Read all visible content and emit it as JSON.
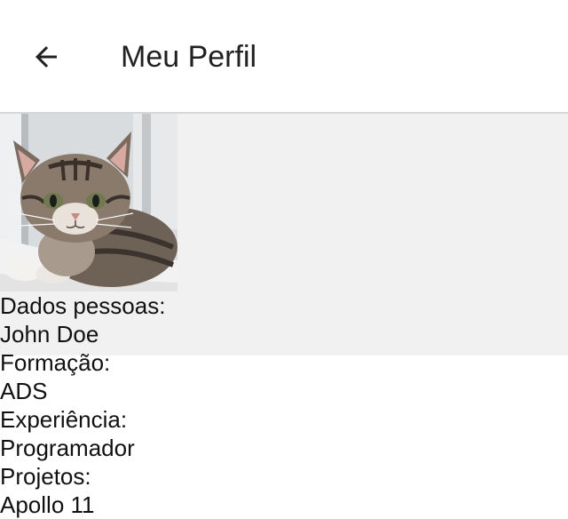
{
  "app_bar": {
    "back_icon": "arrow-left-icon",
    "title": "Meu Perfil"
  },
  "profile": {
    "photo_subject": "tabby kitten",
    "fields": [
      {
        "label": "Dados pessoas:",
        "value": "John Doe"
      },
      {
        "label": "Formação:",
        "value": "ADS"
      },
      {
        "label": "Experiência:",
        "value": "Programador"
      },
      {
        "label": "Projetos:",
        "value": "Apollo 11"
      }
    ]
  },
  "colors": {
    "panel_background": "#f1f1f1",
    "app_bar_background": "#ffffff",
    "divider": "#d6d6d6",
    "text": "#212121"
  }
}
